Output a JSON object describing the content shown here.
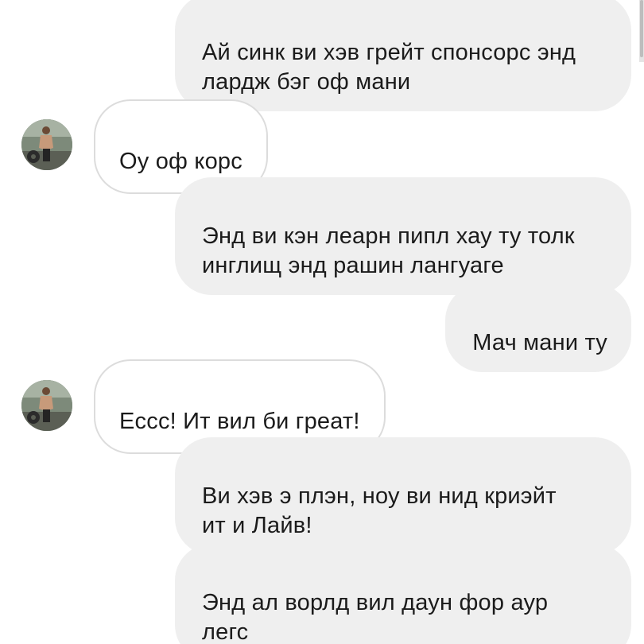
{
  "messages": [
    {
      "side": "outgoing",
      "text": "Ай синк ви хэв грейт спонсорс энд\nлардж бэг оф мани"
    },
    {
      "side": "incoming",
      "avatar_icon": "user-avatar-photo",
      "text": "Оу оф корс"
    },
    {
      "side": "outgoing",
      "text": "Энд ви кэн леарн пипл хау ту толк\nинглищ энд рашин лангуаге"
    },
    {
      "side": "outgoing",
      "text": "Мач мани ту"
    },
    {
      "side": "incoming",
      "avatar_icon": "user-avatar-photo",
      "text": "Еccc! Ит вил би греат!"
    },
    {
      "side": "outgoing",
      "text": "Ви хэв э плэн, ноу ви нид криэйт\nит и Лайв!"
    },
    {
      "side": "outgoing",
      "text": "Энд ал ворлд вил даун фор аур\nлегс"
    }
  ],
  "colors": {
    "outgoing_bubble": "#efefef",
    "incoming_border": "#dcdcdc",
    "text": "#1b1b1b"
  }
}
